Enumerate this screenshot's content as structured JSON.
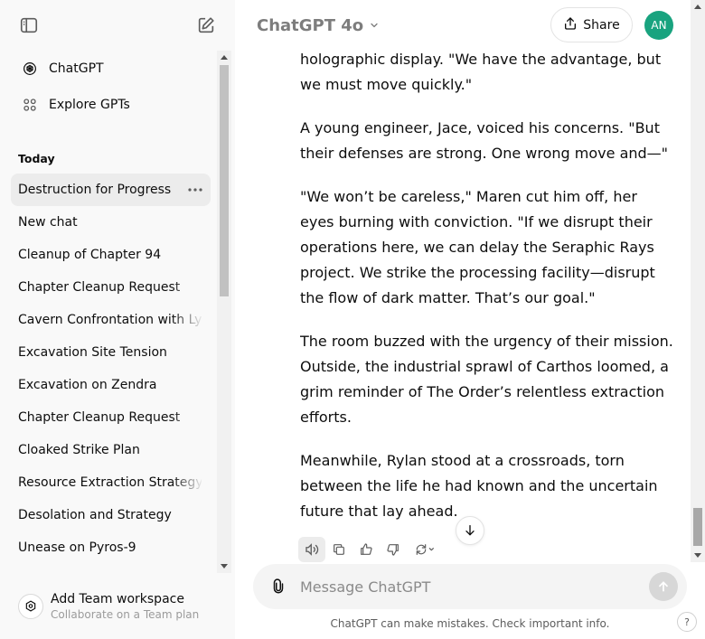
{
  "sidebar": {
    "nav": [
      {
        "label": "ChatGPT",
        "icon": "openai-logo-icon"
      },
      {
        "label": "Explore GPTs",
        "icon": "grid-icon"
      }
    ],
    "section_title": "Today",
    "chats": [
      {
        "label": "Destruction for Progress",
        "active": true
      },
      {
        "label": "New chat"
      },
      {
        "label": "Cleanup of Chapter 94"
      },
      {
        "label": "Chapter Cleanup Request"
      },
      {
        "label": "Cavern Confrontation with Lyra"
      },
      {
        "label": "Excavation Site Tension"
      },
      {
        "label": "Excavation on Zendra"
      },
      {
        "label": "Chapter Cleanup Request"
      },
      {
        "label": "Cloaked Strike Plan"
      },
      {
        "label": "Resource Extraction Strategy"
      },
      {
        "label": "Desolation and Strategy"
      },
      {
        "label": "Unease on Pyros-9"
      }
    ],
    "workspace": {
      "title": "Add Team workspace",
      "subtitle": "Collaborate on a Team plan"
    }
  },
  "header": {
    "model": "ChatGPT 4o",
    "share_label": "Share",
    "avatar_initials": "AN",
    "avatar_color": "#19a37f"
  },
  "message": {
    "paragraphs": [
      [
        "holographic display. \"We have the advantage, but",
        "we must move quickly.\""
      ],
      [
        "A young engineer, Jace, voiced his concerns. \"But",
        "their defenses are strong. One wrong move and—\""
      ],
      [
        "\"We won’t be careless,\" Maren cut him off, her",
        "eyes burning with conviction. \"If we disrupt their",
        "operations here, we can delay the Seraphic Rays",
        "project. We strike the processing facility—disrupt",
        "the flow of dark matter. That’s our goal.\""
      ],
      [
        "The room buzzed with the urgency of their mission.",
        "Outside, the industrial sprawl of Carthos loomed, a",
        "grim reminder of The Order’s relentless extraction",
        "efforts."
      ],
      [
        "Meanwhile, Rylan stood at a crossroads, torn",
        "between the life he had known and the uncertain",
        "future that lay ahead."
      ]
    ]
  },
  "composer": {
    "placeholder": "Message ChatGPT"
  },
  "footer": {
    "disclaimer": "ChatGPT can make mistakes. Check important info.",
    "help": "?"
  }
}
